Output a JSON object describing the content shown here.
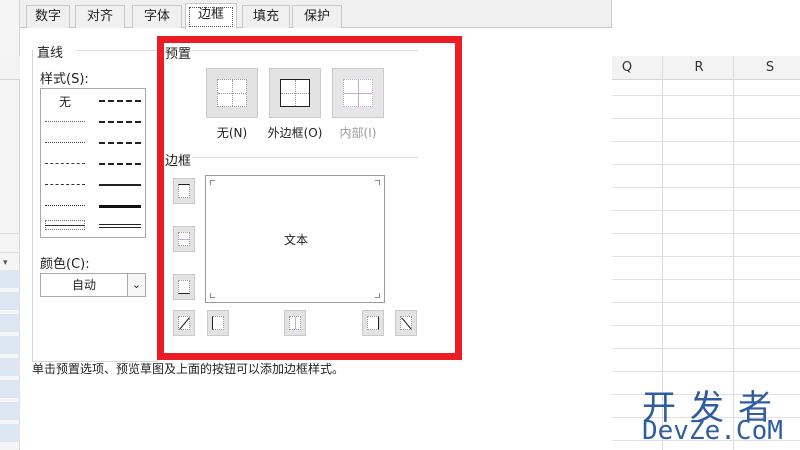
{
  "sheet": {
    "columns": [
      "Q",
      "R",
      "S"
    ]
  },
  "dialog": {
    "tabs": [
      {
        "label": "数字",
        "active": false
      },
      {
        "label": "对齐",
        "active": false
      },
      {
        "label": "字体",
        "active": false
      },
      {
        "label": "边框",
        "active": true
      },
      {
        "label": "填充",
        "active": false
      },
      {
        "label": "保护",
        "active": false
      }
    ],
    "line_group_label": "直线",
    "style_label": "样式(S):",
    "style_none": "无",
    "color_label": "颜色(C):",
    "color_value": "自动",
    "presets_label": "预置",
    "presets": {
      "none_label": "无(N)",
      "outline_label": "外边框(O)",
      "inside_label": "内部(I)"
    },
    "border_label": "边框",
    "preview_text": "文本",
    "hint": "单击预置选项、预览草图及上面的按钮可以添加边框样式。"
  },
  "watermark": {
    "top": "开发者",
    "bottom": "DevZe.CoM"
  },
  "colors": {
    "highlight": "#ec1c24",
    "watermark": "#2f5d9f"
  }
}
